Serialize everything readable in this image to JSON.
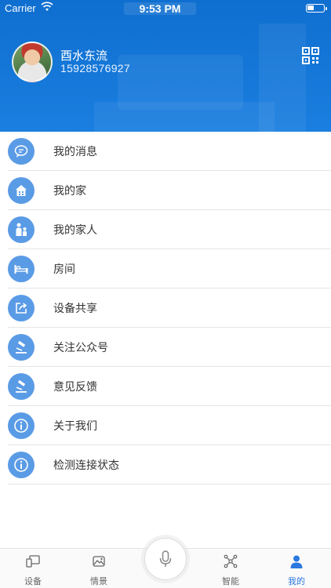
{
  "status_bar": {
    "carrier": "Carrier",
    "time": "9:53 PM"
  },
  "profile": {
    "name": "酉水东流",
    "phone": "15928576927"
  },
  "menu": [
    {
      "label": "我的消息",
      "icon": "message-icon"
    },
    {
      "label": "我的家",
      "icon": "home-icon"
    },
    {
      "label": "我的家人",
      "icon": "family-icon"
    },
    {
      "label": "房间",
      "icon": "bed-icon"
    },
    {
      "label": "设备共享",
      "icon": "share-icon"
    },
    {
      "label": "关注公众号",
      "icon": "gavel-icon"
    },
    {
      "label": "意见反馈",
      "icon": "gavel-icon"
    },
    {
      "label": "关于我们",
      "icon": "info-icon"
    },
    {
      "label": "检测连接状态",
      "icon": "info-icon"
    }
  ],
  "tabbar": {
    "tabs": [
      {
        "label": "设备",
        "icon": "device-icon"
      },
      {
        "label": "情景",
        "icon": "scene-icon"
      },
      {
        "label": "智能",
        "icon": "smart-icon"
      },
      {
        "label": "我的",
        "icon": "profile-icon",
        "active": true
      }
    ],
    "center_icon": "microphone-icon"
  },
  "colors": {
    "header_blue": "#1577d8",
    "icon_blue": "#5a9be6",
    "active_tab": "#2a78e0"
  }
}
